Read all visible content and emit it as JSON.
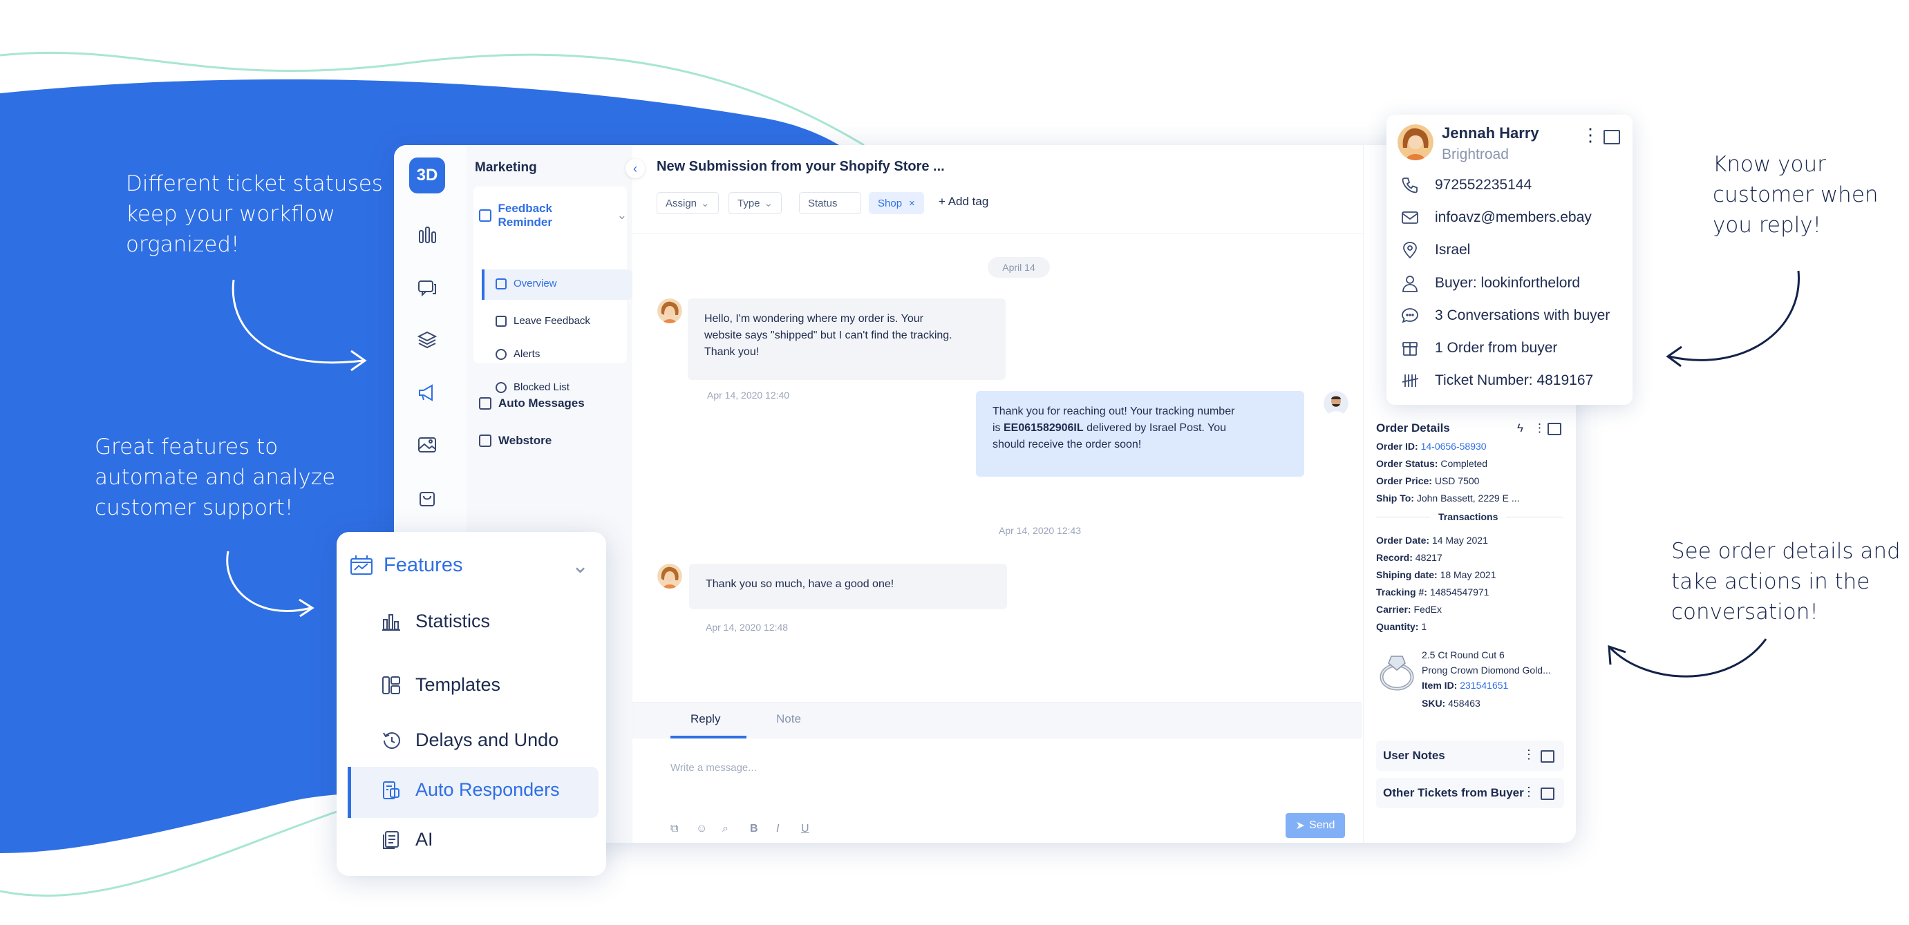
{
  "colors": {
    "brand_blue": "#2f6fe4",
    "wave_green": "#a8e6d4",
    "dark_text": "#1d2b4f"
  },
  "captions": {
    "statuses": [
      "Different ticket statuses",
      "keep your workflow",
      "organized!"
    ],
    "features": [
      "Great features to",
      "automate and analyze",
      "customer support!"
    ],
    "know": [
      "Know your",
      "customer when",
      "you reply!"
    ],
    "orders": [
      "See order details and",
      "take actions in the",
      "conversation!"
    ]
  },
  "rail": {
    "logo": "3D"
  },
  "subnav": {
    "title": "Marketing",
    "group": "Feedback Reminder",
    "items": [
      "Overview",
      "Leave Feedback",
      "Alerts",
      "Blocked List"
    ],
    "sections": [
      "Auto Messages",
      "Webstore"
    ]
  },
  "header": {
    "title": "New Submission from your Shopify Store ...",
    "filters": [
      "Assign",
      "Type",
      "Status"
    ],
    "tag": "Shop",
    "add_tag": "+ Add tag"
  },
  "chat": {
    "date": "April 14",
    "messages": [
      {
        "lines": [
          "Hello, I'm wondering where my order is. Your",
          "website says \"shipped\" but I can't find the tracking.",
          "Thank you!"
        ],
        "time": "Apr 14, 2020 12:40"
      },
      {
        "line1": "Thank you for reaching out! Your tracking number",
        "is": "is ",
        "tracking": "EE061582906IL",
        "rest": " delivered by Israel Post. You",
        "line3": "should receive the order soon!",
        "time": "Apr 14, 2020 12:43"
      },
      {
        "lines": [
          "Thank you so much, have a good one!"
        ],
        "time": "Apr 14, 2020 12:48"
      }
    ]
  },
  "reply": {
    "tabs": [
      "Reply",
      "Note"
    ],
    "placeholder": "Write a message...",
    "format_icons": [
      "B",
      "I",
      "U"
    ],
    "send": "Send"
  },
  "contact": {
    "name": "Jennah Harry",
    "company": "Brightroad",
    "phone": "972552235144",
    "email": "infoavz@members.ebay",
    "location": "Israel",
    "buyer": "Buyer: lookinforthelord",
    "conversations": "3 Conversations with buyer",
    "orders": "1 Order from buyer",
    "ticket": "Ticket Number: 4819167"
  },
  "order": {
    "title": "Order Details",
    "id_label": "Order ID:",
    "id": "14-0656-58930",
    "status_label": "Order Status:",
    "status": "Completed",
    "price_label": "Order Price:",
    "price": "USD 7500",
    "ship_label": "Ship To:",
    "ship": "John Bassett, 2229 E ...",
    "transactions": "Transactions",
    "date_label": "Order Date:",
    "date": "14 May 2021",
    "record_label": "Record:",
    "record": "48217",
    "shipdate_label": "Shiping date:",
    "shipdate": "18 May 2021",
    "tracking_label": "Tracking #:",
    "tracking": "14854547971",
    "carrier_label": "Carrier:",
    "carrier": "FedEx",
    "qty_label": "Quantity:",
    "qty": "1",
    "item_line1": "2.5 Ct Round Cut 6",
    "item_line2": "Prong Crown Diomond Gold...",
    "item_id_label": "Item ID:",
    "item_id": "231541651",
    "sku_label": "SKU:",
    "sku": "458463"
  },
  "side_cards": [
    "User Notes",
    "Other Tickets from Buyer"
  ],
  "features": {
    "title": "Features",
    "items": [
      "Statistics",
      "Templates",
      "Delays and Undo",
      "Auto Responders",
      "AI"
    ]
  }
}
